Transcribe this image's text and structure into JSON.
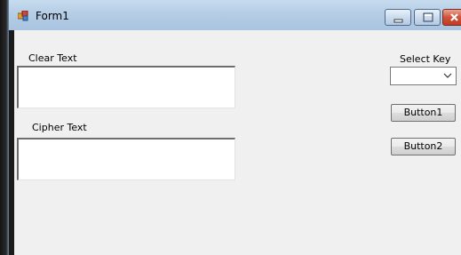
{
  "window": {
    "title": "Form1"
  },
  "labels": {
    "clear_text": "Clear Text",
    "cipher_text": "Cipher Text",
    "select_key": "Select Key"
  },
  "inputs": {
    "clear_text_value": "",
    "cipher_text_value": "",
    "select_key_selected": ""
  },
  "buttons": {
    "button1": "Button1",
    "button2": "Button2"
  },
  "icons": {
    "app": "form-app-icon",
    "minimize": "minimize-icon",
    "maximize": "maximize-icon",
    "close": "close-icon",
    "dropdown": "chevron-down-icon"
  },
  "colors": {
    "titlebar": "#b5cde6",
    "client_background": "#f0f0f0",
    "close_button": "#c23b22"
  }
}
